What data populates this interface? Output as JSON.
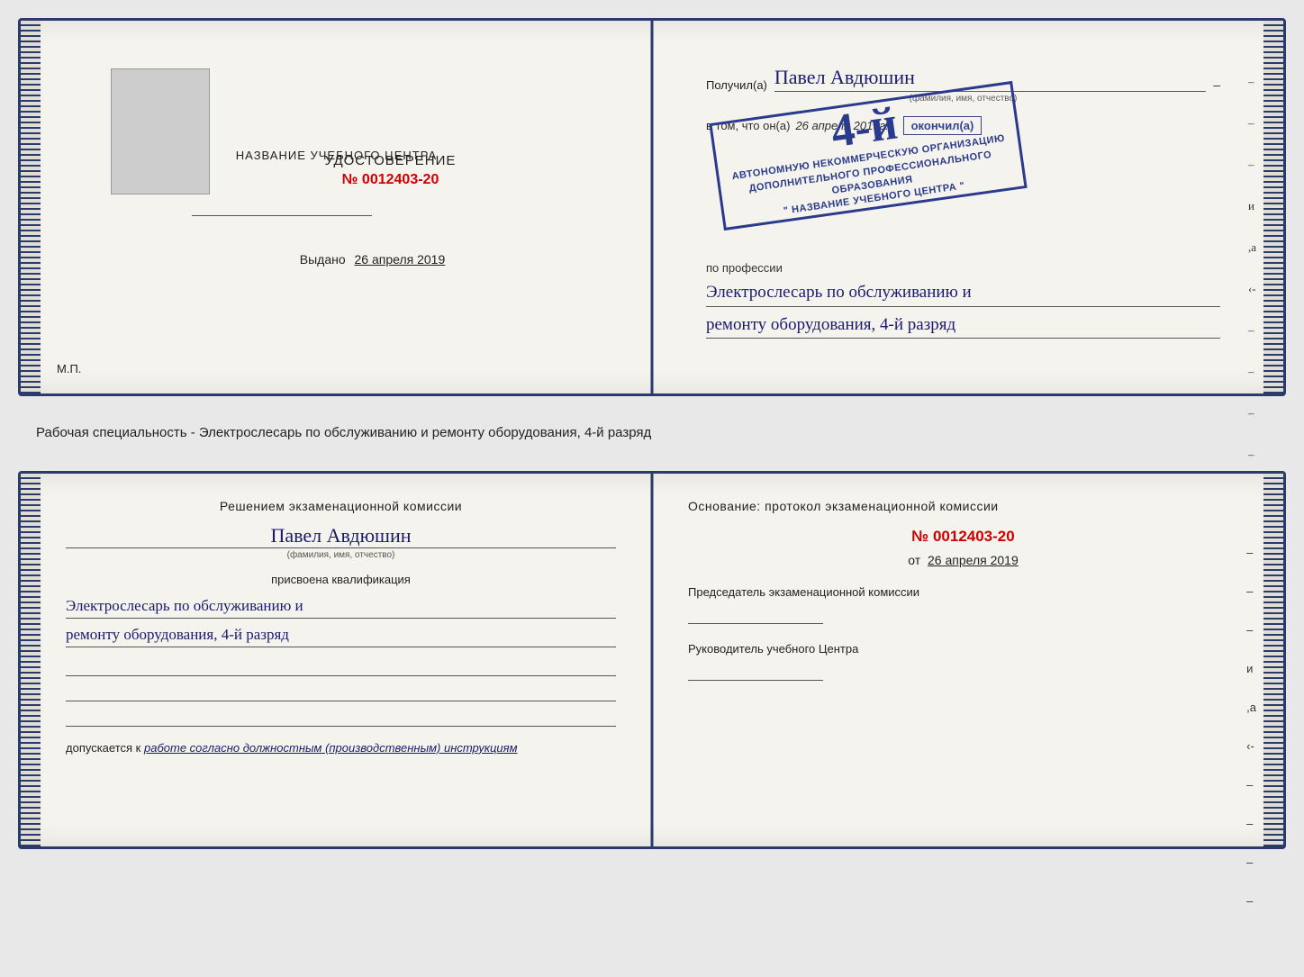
{
  "top_doc": {
    "left": {
      "center_title": "НАЗВАНИЕ УЧЕБНОГО ЦЕНТРА",
      "udostoverenie_title": "УДОСТОВЕРЕНИЕ",
      "udostoverenie_number": "№ 0012403-20",
      "vydano_label": "Выдано",
      "vydano_date": "26 апреля 2019",
      "mp": "М.П."
    },
    "right": {
      "poluchil_label": "Получил(а)",
      "person_name": "Павел Авдюшин",
      "fio_hint": "(фамилия, имя, отчество)",
      "vtom_label": "в том, что он(а)",
      "vtom_date": "26 апреля 2019г.",
      "okonchil_label": "окончил(а)",
      "stamp_grade": "4-й",
      "stamp_line1": "АВТОНОМНУЮ НЕКОММЕРЧЕСКУЮ ОРГАНИЗАЦИЮ",
      "stamp_line2": "ДОПОЛНИТЕЛЬНОГО ПРОФЕССИОНАЛЬНОГО ОБРАЗОВАНИЯ",
      "stamp_line3": "\" НАЗВАНИЕ УЧЕБНОГО ЦЕНТРА \"",
      "profession_label": "по профессии",
      "profession_handwritten_1": "Электрослесарь по обслуживанию и",
      "profession_handwritten_2": "ремонту оборудования, 4-й разряд",
      "dashes": [
        "-",
        "-",
        "-",
        "и",
        ",а",
        "‹-",
        "-",
        "-",
        "-",
        "-"
      ]
    }
  },
  "middle_text": "Рабочая специальность - Электрослесарь по обслуживанию и ремонту оборудования, 4-й разряд",
  "bottom_doc": {
    "left": {
      "decision_title": "Решением экзаменационной комиссии",
      "person_name": "Павел Авдюшин",
      "fio_hint": "(фамилия, имя, отчество)",
      "prisvoyena_label": "присвоена квалификация",
      "qualification_1": "Электрослесарь по обслуживанию и",
      "qualification_2": "ремонту оборудования, 4-й разряд",
      "dopuskaetsya_label": "допускается к",
      "dopusk_text": "работе согласно должностным (производственным) инструкциям"
    },
    "right": {
      "osnovaniye_label": "Основание: протокол экзаменационной комиссии",
      "protocol_number": "№ 0012403-20",
      "ot_label": "от",
      "ot_date": "26 апреля 2019",
      "chairman_label": "Председатель экзаменационной комиссии",
      "rukvoditel_label": "Руководитель учебного Центра",
      "dashes": [
        "-",
        "-",
        "-",
        "и",
        ",а",
        "‹-",
        "-",
        "-",
        "-",
        "-"
      ]
    }
  }
}
